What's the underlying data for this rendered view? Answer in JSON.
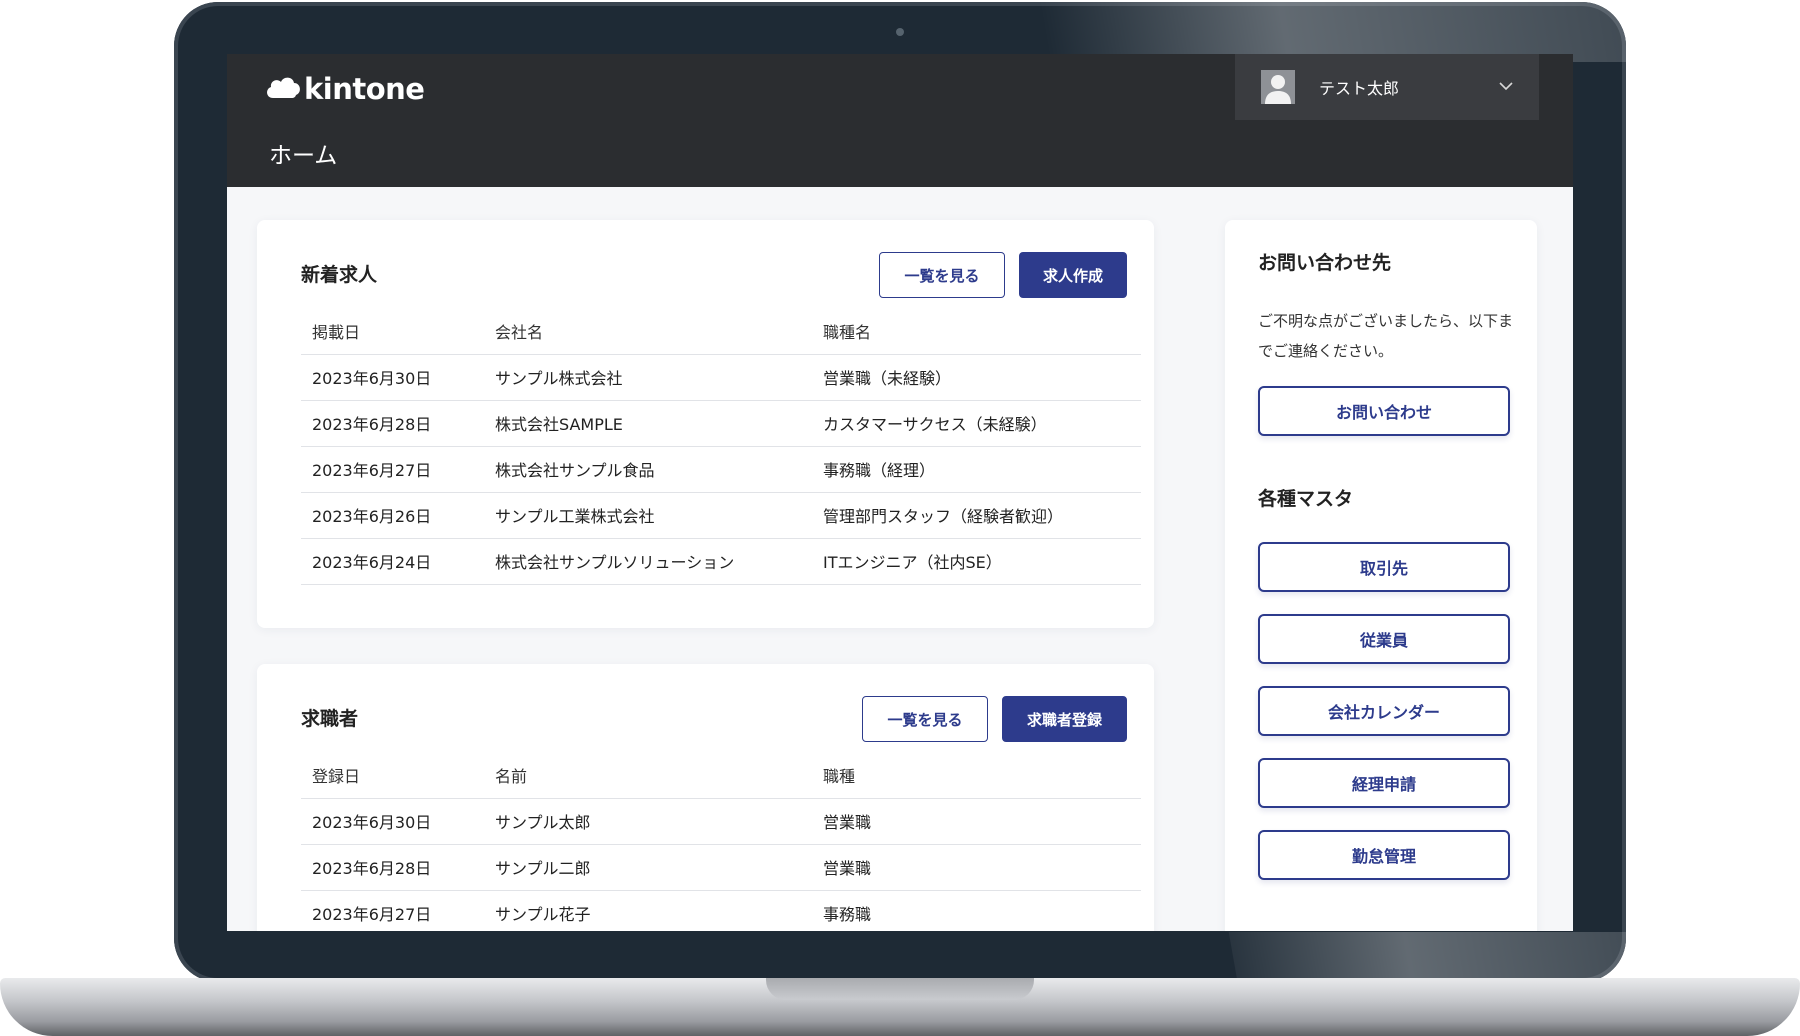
{
  "header": {
    "logo_text": "kintone",
    "page_title": "ホーム",
    "user_name": "テスト太郎",
    "chevron": "⌵"
  },
  "jobs": {
    "title": "新着求人",
    "view_all_label": "一覧を見る",
    "create_label": "求人作成",
    "columns": [
      "掲載日",
      "会社名",
      "職種名"
    ],
    "rows": [
      [
        "2023年6月30日",
        "サンプル株式会社",
        "営業職（未経験）"
      ],
      [
        "2023年6月28日",
        "株式会社SAMPLE",
        "カスタマーサクセス（未経験）"
      ],
      [
        "2023年6月27日",
        "株式会社サンプル食品",
        "事務職（経理）"
      ],
      [
        "2023年6月26日",
        "サンプル工業株式会社",
        "管理部門スタッフ（経験者歓迎）"
      ],
      [
        "2023年6月24日",
        "株式会社サンプルソリューション",
        "ITエンジニア（社内SE）"
      ]
    ]
  },
  "seekers": {
    "title": "求職者",
    "view_all_label": "一覧を見る",
    "register_label": "求職者登録",
    "columns": [
      "登録日",
      "名前",
      "職種"
    ],
    "rows": [
      [
        "2023年6月30日",
        "サンプル太郎",
        "営業職"
      ],
      [
        "2023年6月28日",
        "サンプル二郎",
        "営業職"
      ],
      [
        "2023年6月27日",
        "サンプル花子",
        "事務職"
      ]
    ]
  },
  "sidebar": {
    "contact_title": "お問い合わせ先",
    "contact_text": "ご不明な点がございましたら、以下までご連絡ください。",
    "contact_button": "お問い合わせ",
    "master_title": "各種マスタ",
    "master_buttons": [
      "取引先",
      "従業員",
      "会社カレンダー",
      "経理申請",
      "勤怠管理"
    ]
  },
  "colors": {
    "accent": "#2d3b8c",
    "header_bg": "#2b2d30"
  },
  "icons": {
    "logo": "kintone-cloud-icon",
    "avatar": "user-silhouette-icon",
    "dropdown": "chevron-down-icon"
  }
}
